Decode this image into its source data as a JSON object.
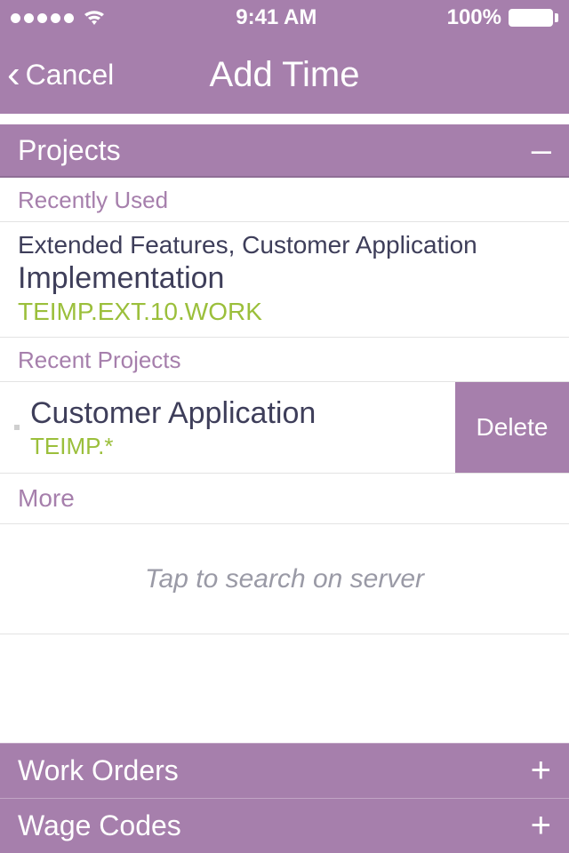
{
  "status": {
    "time": "9:41 AM",
    "battery": "100%"
  },
  "nav": {
    "back": "Cancel",
    "title": "Add Time"
  },
  "sections": {
    "projects": {
      "label": "Projects",
      "indicator": "–"
    },
    "workOrders": {
      "label": "Work Orders",
      "indicator": "+"
    },
    "wageCodes": {
      "label": "Wage Codes",
      "indicator": "+"
    }
  },
  "recentlyUsed": {
    "label": "Recently Used",
    "item": {
      "line1": "Extended Features, Customer Application",
      "line2": "Implementation",
      "code": "TEIMP.EXT.10.WORK"
    }
  },
  "recentProjects": {
    "label": "Recent Projects",
    "item": {
      "title": "Customer Application",
      "code": "TEIMP.*"
    },
    "deleteLabel": "Delete"
  },
  "moreLabel": "More",
  "searchHint": "Tap to search on server"
}
